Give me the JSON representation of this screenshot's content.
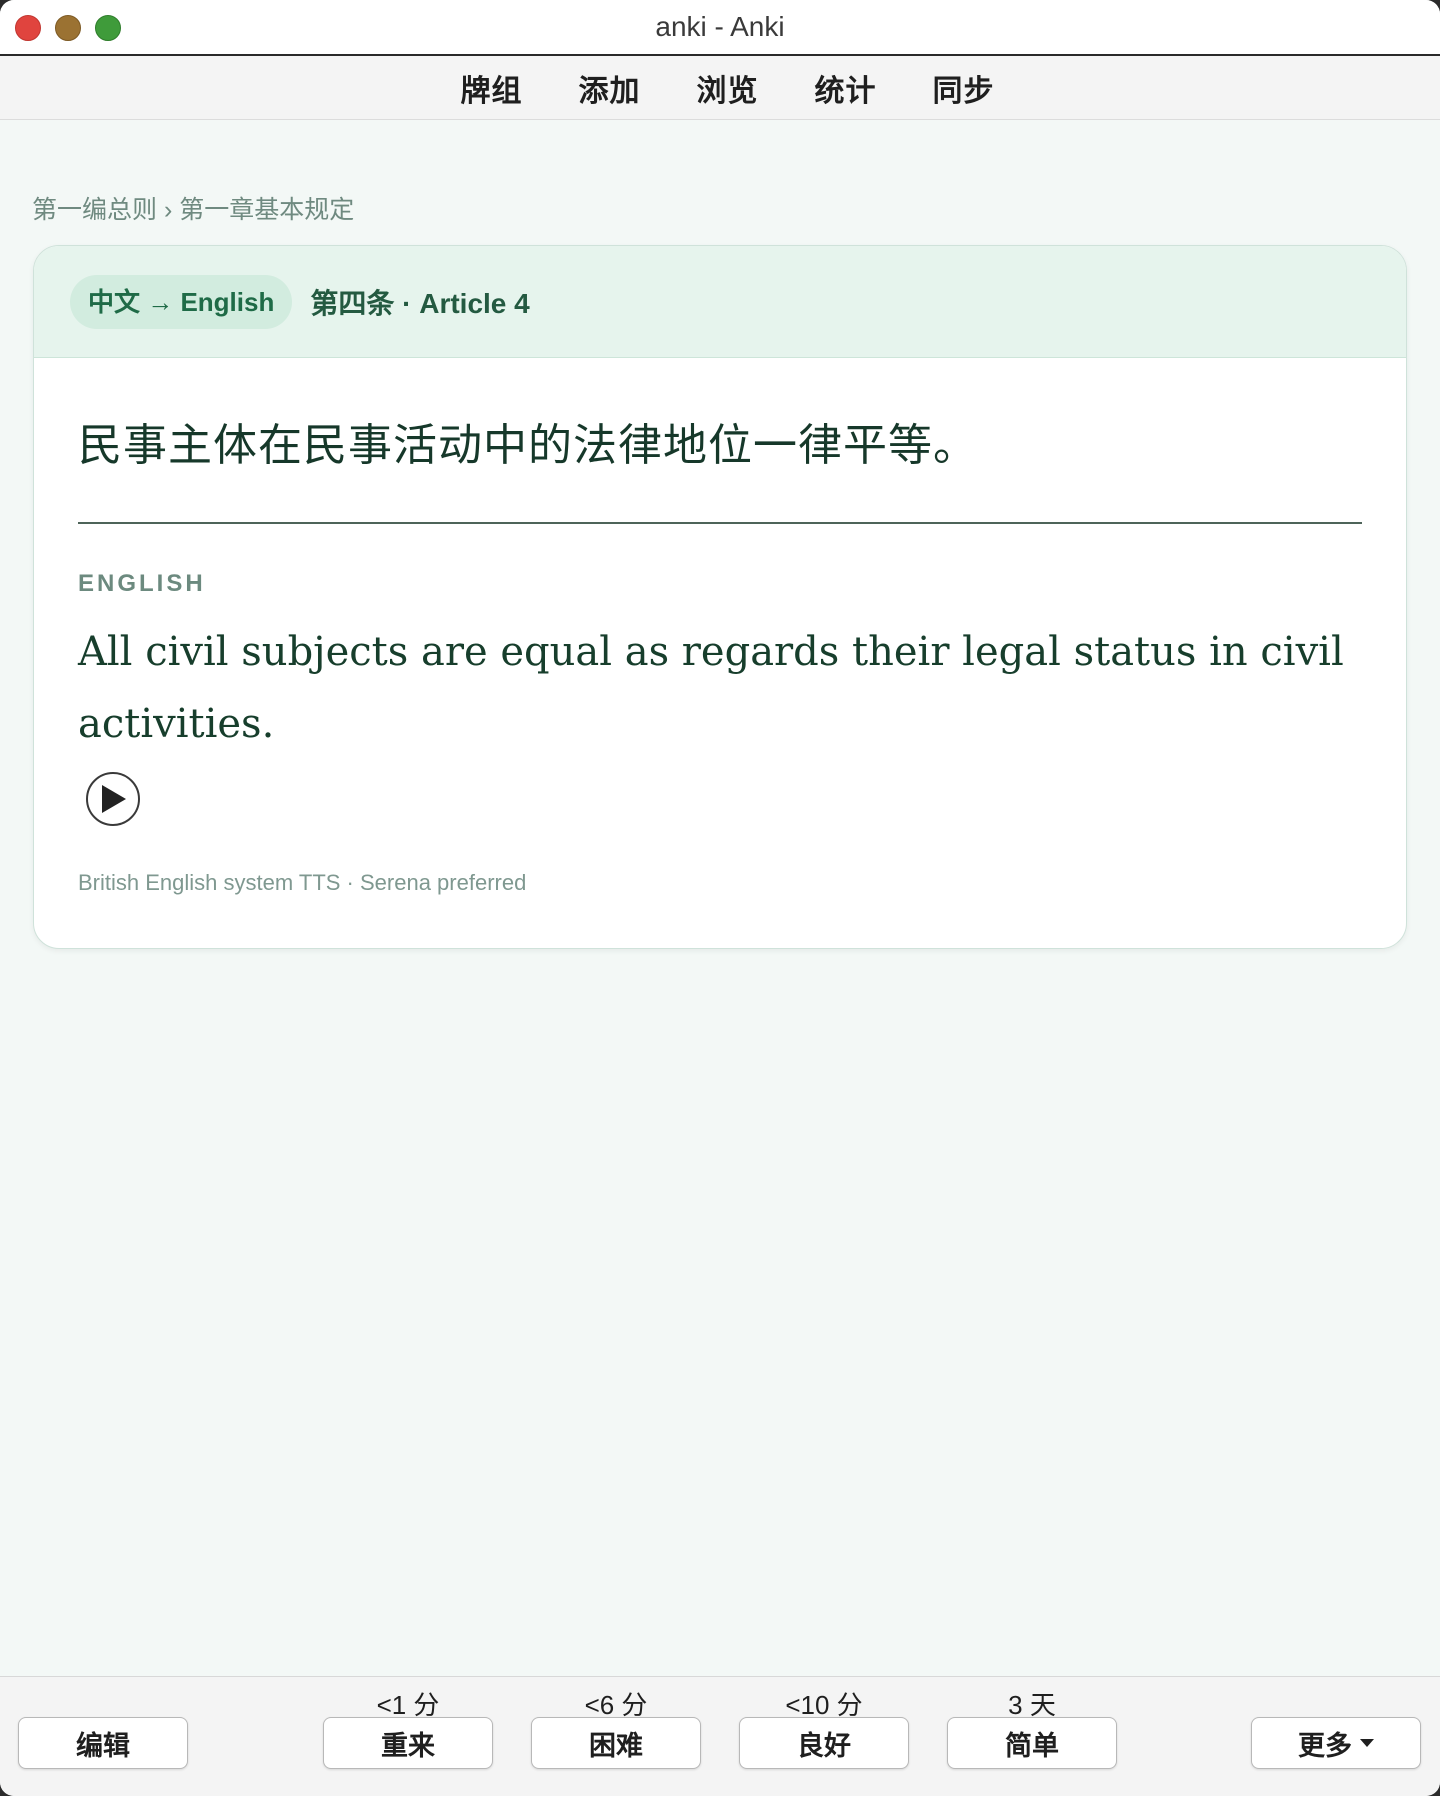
{
  "window": {
    "title": "anki - Anki"
  },
  "toolbar": {
    "items": [
      "牌组",
      "添加",
      "浏览",
      "统计",
      "同步"
    ]
  },
  "breadcrumb": "第一编总则 › 第一章基本规定",
  "card": {
    "direction_pill": "中文 → English",
    "article": "第四条 · Article 4",
    "zh_text": "民事主体在民事活动中的法律地位一律平等。",
    "section_label": "ENGLISH",
    "en_text": "All civil subjects are equal as regards their legal status in civil activities.",
    "tts_note": "British English system TTS · Serena preferred"
  },
  "bottombar": {
    "edit_label": "编辑",
    "answers": [
      {
        "label": "重来",
        "time": "<1 分"
      },
      {
        "label": "困难",
        "time": "<6 分"
      },
      {
        "label": "良好",
        "time": "<10 分"
      },
      {
        "label": "简单",
        "time": "3 天"
      }
    ],
    "more_label": "更多"
  },
  "colors": {
    "accent": "#1f6b47",
    "card_header": "#e6f4ed",
    "background": "#f3f8f6"
  }
}
